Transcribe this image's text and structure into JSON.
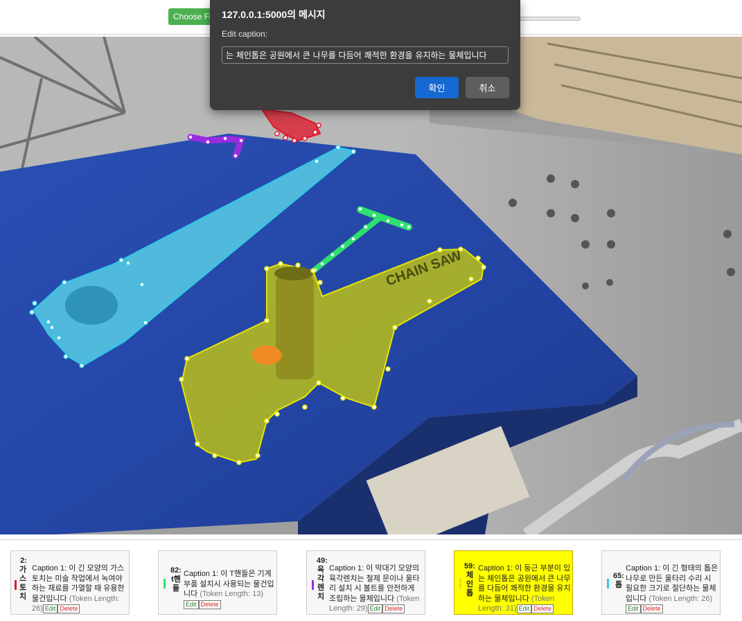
{
  "toolbar": {
    "choose_file_label": "Choose File",
    "colors": {
      "choose_file_bg": "#4caf50"
    }
  },
  "dialog": {
    "title": "127.0.0.1:5000의 메시지",
    "label": "Edit caption:",
    "input_value": "는 체인톱은 공원에서 큰 나무를 다듬어 쾌적한 환경을 유지하는 물체입니다",
    "ok_label": "확인",
    "cancel_label": "취소",
    "colors": {
      "ok_bg": "#1668d2",
      "cancel_bg": "#5e5e5e",
      "bg": "#3c3c3c"
    }
  },
  "scene": {
    "chainsaw_text": "CHAIN SAW",
    "masks": [
      {
        "object": "hand saw",
        "color": "#5ad2e6"
      },
      {
        "object": "T-handle",
        "color": "#2ee06e"
      },
      {
        "object": "hex wrench",
        "color": "#9a2ce0"
      },
      {
        "object": "chainsaw",
        "color": "#d6d600"
      },
      {
        "object": "red object",
        "color": "#e0162a"
      }
    ]
  },
  "captions": [
    {
      "id": "2:",
      "name": "가스토치",
      "text": "Caption 1: 이 긴 모양의 가스토치는 미술 작업에서 녹여야 하는 재료를 가열할 때 유용한 물건입니다",
      "token_label": "(Token Length: 26)",
      "edit": "Edit",
      "delete": "Delete",
      "color": "#e0162a",
      "active": false
    },
    {
      "id": "82:",
      "name": "t핸들",
      "text": "Caption 1: 이 T핸들은 기계 부품 설치시 사용되는 물건입니다",
      "token_label": "(Token Length: 13)",
      "edit": "Edit",
      "delete": "Delete",
      "color": "#2ee06e",
      "active": false
    },
    {
      "id": "49:",
      "name": "육각렌치",
      "text": "Caption 1: 이 막대기 모양의 육각렌치는 철제 문이나 울타리 설치 시 볼트를 안전하게 조립하는 물체입니다",
      "token_label": "(Token Length: 29)",
      "edit": "Edit",
      "delete": "Delete",
      "color": "#9a2ce0",
      "active": false
    },
    {
      "id": "59:",
      "name": "체인톱",
      "text": "Caption 1: 이 둥근 부분이 있는 체인톱은 공원에서 큰 나무를 다듬어 쾌적한 환경을 유지하는 물체입니다",
      "token_label": "(Token Length: 31)",
      "edit": "Edit",
      "delete": "Delete",
      "color": "#e6e600",
      "active": true
    },
    {
      "id": "65:",
      "name": "톱",
      "text": "Caption 1: 이 긴 형태의 톱은 나무로 만든 울타리 수리 시 필요한 크기로 절단하는 물체입니다",
      "token_label": "(Token Length: 26)",
      "edit": "Edit",
      "delete": "Delete",
      "color": "#2ec8e6",
      "active": false
    }
  ]
}
